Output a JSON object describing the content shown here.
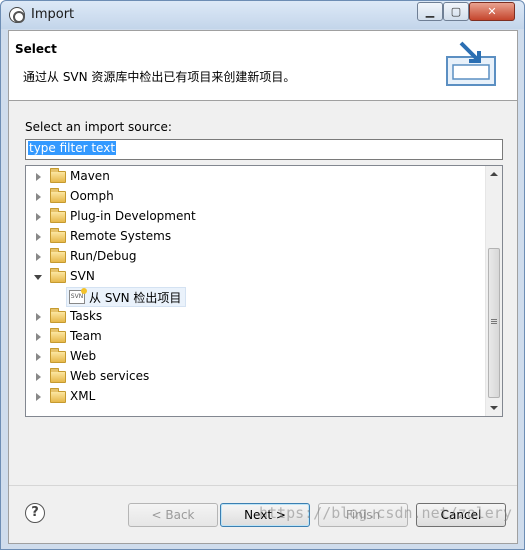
{
  "window": {
    "title": "Import",
    "minimize_icon": "minimize-icon",
    "maximize_icon": "maximize-icon",
    "close_icon": "close-icon"
  },
  "header": {
    "title": "Select",
    "description": "通过从 SVN 资源库中检出已有项目来创建新项目。",
    "graphic_icon": "import-wizard-icon"
  },
  "body": {
    "source_label": "Select an import source:",
    "filter": {
      "value": "type filter text",
      "placeholder": "type filter text"
    },
    "tree": [
      {
        "label": "Maven",
        "expanded": false
      },
      {
        "label": "Oomph",
        "expanded": false
      },
      {
        "label": "Plug-in Development",
        "expanded": false
      },
      {
        "label": "Remote Systems",
        "expanded": false
      },
      {
        "label": "Run/Debug",
        "expanded": false
      },
      {
        "label": "SVN",
        "expanded": true
      },
      {
        "label": "从 SVN 检出项目",
        "child": true,
        "icon": "svn-checkout-icon"
      },
      {
        "label": "Tasks",
        "expanded": false
      },
      {
        "label": "Team",
        "expanded": false
      },
      {
        "label": "Web",
        "expanded": false
      },
      {
        "label": "Web services",
        "expanded": false
      },
      {
        "label": "XML",
        "expanded": false
      }
    ]
  },
  "footer": {
    "help_icon": "help-icon",
    "back_label": "< Back",
    "next_label": "Next >",
    "finish_label": "Finish",
    "cancel_label": "Cancel"
  },
  "watermark": "https://blog.csdn.net/zolery"
}
